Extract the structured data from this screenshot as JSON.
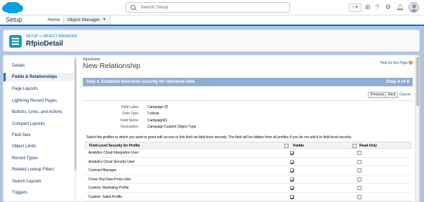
{
  "global_header": {
    "search_placeholder": "Search Setup",
    "icons": [
      "star-icon",
      "plus-icon",
      "help-icon",
      "gear-icon",
      "notifications-icon",
      "avatar"
    ]
  },
  "nav": {
    "app_name": "Setup",
    "tabs": [
      {
        "label": "Home"
      },
      {
        "label": "Object Manager"
      }
    ],
    "dropdown_glyph": "▼"
  },
  "page_header": {
    "breadcrumb_setup": "SETUP",
    "breadcrumb_sep": " > ",
    "breadcrumb_object_manager": "OBJECT MANAGER",
    "title": "RfpioDetail"
  },
  "sidebar": {
    "items": [
      {
        "label": "Details"
      },
      {
        "label": "Fields & Relationships"
      },
      {
        "label": "Page Layouts"
      },
      {
        "label": "Lightning Record Pages"
      },
      {
        "label": "Buttons, Links, and Actions"
      },
      {
        "label": "Compact Layouts"
      },
      {
        "label": "Field Sets"
      },
      {
        "label": "Object Limits"
      },
      {
        "label": "Record Types"
      },
      {
        "label": "Related Lookup Filters"
      },
      {
        "label": "Search Layouts"
      },
      {
        "label": "Triggers"
      }
    ]
  },
  "content": {
    "object_small": "RfpioDetail",
    "heading": "New Relationship",
    "help_link": "Help for this Page",
    "step_title": "Step 4. Establish field-level security for reference field",
    "step_num": "Step 4 of 6",
    "buttons": {
      "previous": "Previous",
      "next": "Next",
      "cancel": "Cancel"
    },
    "details": [
      {
        "label": "Field Label",
        "value": "Campaign ID"
      },
      {
        "label": "Data Type",
        "value": "Lookup"
      },
      {
        "label": "Field Name",
        "value": "CampaignID"
      },
      {
        "label": "Description",
        "value": "Campaign Custom Object Type"
      }
    ],
    "instructions": "Select the profiles to which you want to grant edit access to this field via field-level security. The field will be hidden from all profiles if you do not add it to field-level security.",
    "table": {
      "col_profile": "Field-Level Security for Profile",
      "col_visible": "Visible",
      "col_readonly": "Read-Only",
      "rows": [
        {
          "profile": "Analytics Cloud Integration User",
          "visible": true,
          "readonly": false
        },
        {
          "profile": "Analytics Cloud Security User",
          "visible": true,
          "readonly": false
        },
        {
          "profile": "Contract Manager",
          "visible": true,
          "readonly": false
        },
        {
          "profile": "Cross Org Data Proxy User",
          "visible": true,
          "readonly": false
        },
        {
          "profile": "Custom: Marketing Profile",
          "visible": true,
          "readonly": false
        },
        {
          "profile": "Custom: Sales Profile",
          "visible": true,
          "readonly": false
        }
      ]
    }
  }
}
